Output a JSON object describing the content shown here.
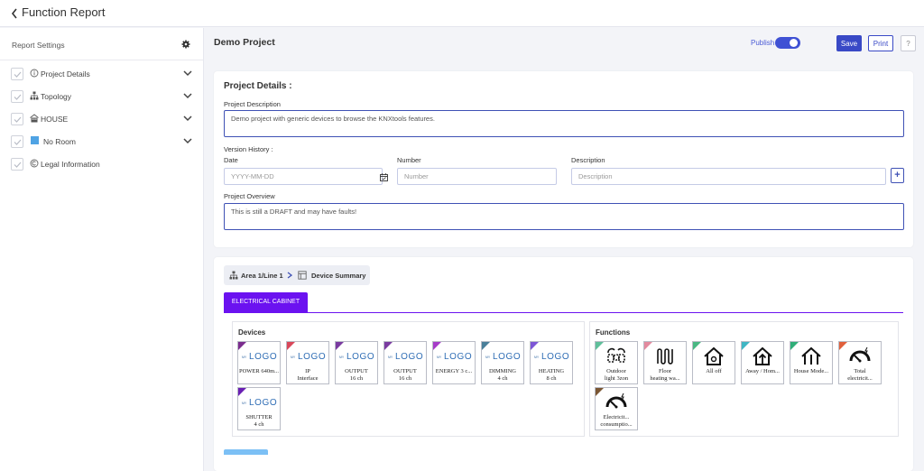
{
  "header": {
    "title": "Function Report"
  },
  "sidebar": {
    "heading": "Report Settings",
    "items": [
      {
        "label": "Project Details",
        "icon": "info-circle-icon",
        "expandable": true
      },
      {
        "label": "Topology",
        "icon": "topology-icon",
        "expandable": true
      },
      {
        "label": "HOUSE",
        "icon": "building-icon",
        "expandable": true
      },
      {
        "label": "No Room",
        "icon": "room-square-icon",
        "expandable": true
      },
      {
        "label": "Legal Information",
        "icon": "copyright-icon",
        "expandable": false
      }
    ]
  },
  "main": {
    "project_name": "Demo Project",
    "publish_label": "Publish",
    "publish_on": true,
    "save_label": "Save",
    "print_label": "Print",
    "help_label": "?",
    "details": {
      "title": "Project Details :",
      "description_label": "Project Description",
      "description_value": "Demo project with generic devices to browse the KNXtools features.",
      "version_history_label": "Version History :",
      "date_label": "Date",
      "date_placeholder": "YYYY-MM-DD",
      "number_label": "Number",
      "number_placeholder": "Number",
      "desc_label": "Description",
      "desc_placeholder": "Description",
      "add_label": "+",
      "overview_label": "Project Overview",
      "overview_value": "This is still a DRAFT and may have faults!"
    },
    "breadcrumb": {
      "first": "Area 1/Line 1",
      "second": "Device Summary"
    },
    "tab": "ELECTRICAL CABINET",
    "devices_title": "Devices",
    "functions_title": "Functions",
    "logo_text": "LOGO",
    "logo_prefix": "MY",
    "devices": [
      {
        "line1": "POWER 640m...",
        "line2": "",
        "color": "#7b2d8e"
      },
      {
        "line1": "IP",
        "line2": "Interface",
        "color": "#d9475a"
      },
      {
        "line1": "OUTPUT",
        "line2": "16 ch",
        "color": "#7a3ba0"
      },
      {
        "line1": "OUTPUT",
        "line2": "16 ch",
        "color": "#7a3ba0"
      },
      {
        "line1": "ENERGY 3 c...",
        "line2": "",
        "color": "#a63cc8"
      },
      {
        "line1": "DIMMING",
        "line2": "4 ch",
        "color": "#4a7f9a"
      },
      {
        "line1": "HEATING",
        "line2": "8 ch",
        "color": "#7c56d6"
      },
      {
        "line1": "SHUTTER",
        "line2": "4 ch",
        "color": "#6a1fb3"
      }
    ],
    "functions": [
      {
        "line1": "Outdoor",
        "line2": "light 3zon",
        "color": "#5fbf9a",
        "icon": "lights-icon"
      },
      {
        "line1": "Floor",
        "line2": "heating wa...",
        "color": "#e38a9e",
        "icon": "floor-heating-icon"
      },
      {
        "line1": "All off",
        "line2": "",
        "color": "#49b883",
        "icon": "house-off-icon"
      },
      {
        "line1": "Away / Hom...",
        "line2": "",
        "color": "#3fb6c4",
        "icon": "house-away-icon"
      },
      {
        "line1": "House Mode...",
        "line2": "",
        "color": "#2fae78",
        "icon": "house-mode-icon"
      },
      {
        "line1": "Total",
        "line2": "electricit...",
        "color": "#e0603c",
        "icon": "gauge-icon"
      },
      {
        "line1": "Electricit...",
        "line2": "consumptio...",
        "color": "#7a5633",
        "icon": "gauge-icon"
      }
    ]
  }
}
